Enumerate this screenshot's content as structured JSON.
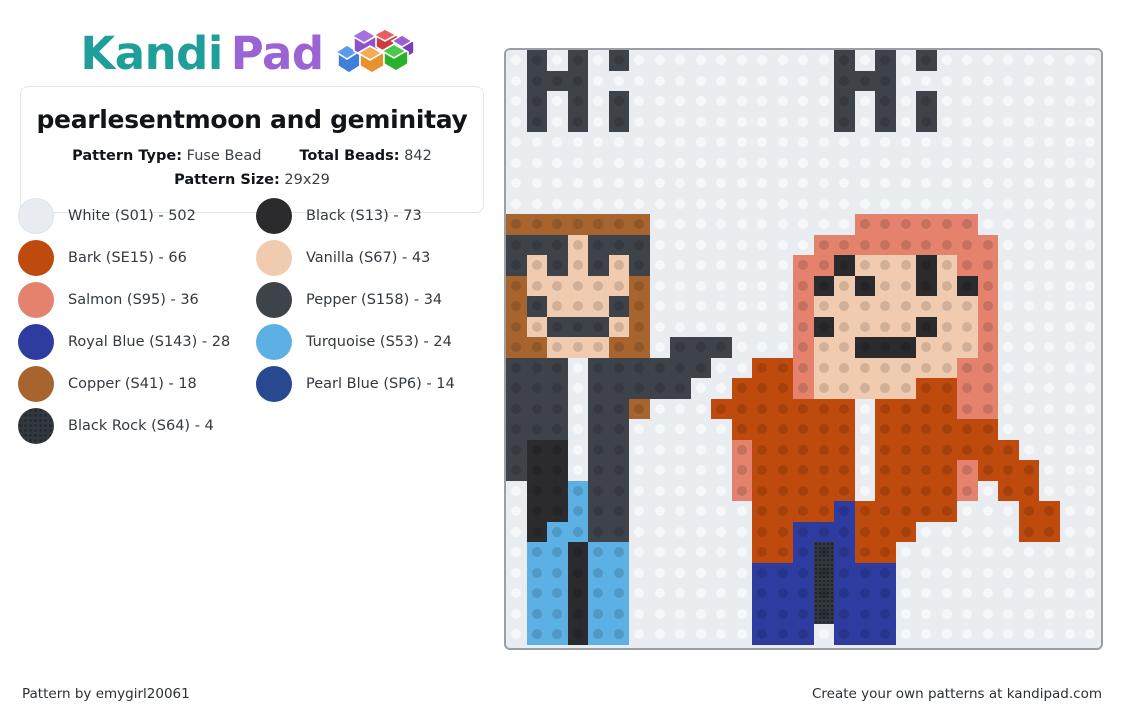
{
  "brand": {
    "name_part1": "Kandi",
    "name_part2": "Pad",
    "logo_icon": "bead-pile-icon",
    "color_teal": "#1f9f9a",
    "color_purple": "#9b63d3"
  },
  "info_card": {
    "title": "pearlesentmoon and geminitay",
    "pattern_type_label": "Pattern Type:",
    "pattern_type_value": "Fuse Bead",
    "total_beads_label": "Total Beads:",
    "total_beads_value": "842",
    "pattern_size_label": "Pattern Size:",
    "pattern_size_value": "29x29"
  },
  "legend": [
    {
      "name": "White (S01) - 502",
      "hex": "#e9edf2",
      "key": "W"
    },
    {
      "name": "Black (S13) - 73",
      "hex": "#2b2b2e",
      "key": "K"
    },
    {
      "name": "Bark (SE15) - 66",
      "hex": "#bf4a0d",
      "key": "B"
    },
    {
      "name": "Vanilla (S67) - 43",
      "hex": "#f0cbb0",
      "key": "V"
    },
    {
      "name": "Salmon (S95) - 36",
      "hex": "#e4826e",
      "key": "S"
    },
    {
      "name": "Pepper (S158) - 34",
      "hex": "#3e434a",
      "key": "P"
    },
    {
      "name": "Royal Blue (S143) - 28",
      "hex": "#2e3ca0",
      "key": "R"
    },
    {
      "name": "Turquoise (S53) - 24",
      "hex": "#5cb0e4",
      "key": "T"
    },
    {
      "name": "Copper (S41) - 18",
      "hex": "#a8642f",
      "key": "C"
    },
    {
      "name": "Pearl Blue (SP6) - 14",
      "hex": "#27498f",
      "key": "L"
    },
    {
      "name": "Black Rock (S64) - 4",
      "hex": "#33383f",
      "key": "N"
    }
  ],
  "grid": {
    "cols": 29,
    "rows": 29,
    "palette": {
      "W": "#e9edf2",
      "K": "#2b2b2e",
      "B": "#bf4a0d",
      "V": "#f0cbb0",
      "S": "#e4826e",
      "P": "#3e434a",
      "R": "#2e3ca0",
      "T": "#5cb0e4",
      "C": "#a8642f",
      "L": "#27498f",
      "N": "#33383f"
    },
    "rows_data": [
      "WPWPWPWWWWWWWWWWPWPWPWWWWWWWW",
      "WPPPWWWWWWWWWWWWPPPWWWWWWWWWW",
      "WPWPWPWWWWWWWWWWPWPWPWWWWWWWW",
      "WPWPWPWWWWWWWWWWPWPWPWWWWWWWW",
      "WWWWWWWWWWWWWWWWWWWWWWWWWWWWW",
      "WWWWWWWWWWWWWWWWWWWWWWWWWWWWW",
      "WWWWWWWWWWWWWWWWWWWWWWWWWWWWW",
      "WWWWWWWWWWWWWWWWWWWWWWWWWWWWW",
      "CCCCCCCWWWWWWWWWWSSSSSSWWWWWW",
      "PPPVPPPWWWWWWWWSSSSSSSSSWWWWW",
      "PVPVPVPWWWWWWWSSKVVVKVSSWWWWW",
      "CVVVVVCWWWWWWWSKVKVVKVKSWWWWW",
      "CPVVVPCWWWWWWWSVVVVVVVVSWWWWW",
      "CVPPPVCWWWWWWWSKVVVVKVVSWWWWW",
      "CCVVVCCWPPPWWWSVVKKKVVVSWWWWW",
      "PPPWPPPPPPWWBBSVVVVVVVSSWWWWW",
      "PPPWPPPPPWWBBBSVVVVVBBSSWWWWW",
      "PPPWPPCWWWBBBBBBBWBBBBSSWWWWW",
      "PPPWPPWWWWWBBBBBBWBBBBBBWWWWW",
      "PKKWPPWWWWWSBBBBBWBBBBBBBWWWW",
      "PKKWPPWWWWWSBBBBBWBBBBSBBBWWW",
      "WKKTPPWWWWWSBBBBBWBBBBSWBBWWW",
      "WKKTPPWWWWWWBBBBRBBBBBWWWBBWW",
      "WKTTPPWWWWWWBBRRRBBBWWWWWBBWW",
      "WTTKTTWWWWWWBBRNRBBWWWWWWWWWW",
      "WTTKTTWWWWWWRRRNRRRWWWWWWWWWW",
      "WTTKTTWWWWWWRRRNRRRWWWWWWWWWW",
      "WTTKTTWWWWWWRRRNRRRWWWWWWWWWW",
      "WTTKTTWWWWWWRRRWRRRWWWWWWWWWW"
    ]
  },
  "footer": {
    "left": "Pattern by emygirl20061",
    "right": "Create your own patterns at kandipad.com"
  }
}
